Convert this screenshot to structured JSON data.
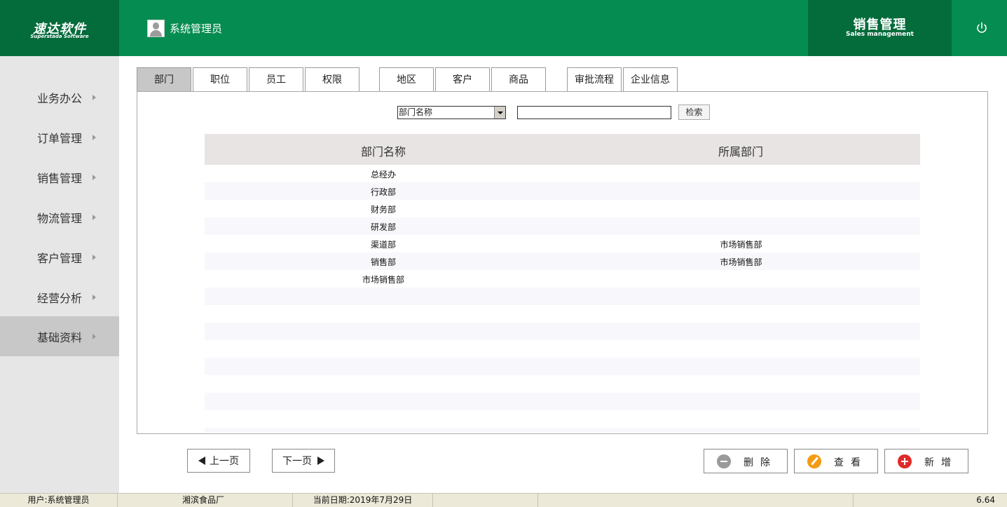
{
  "header": {
    "logo_cn": "速达软件",
    "logo_en": "Superstada Software",
    "user_name": "系统管理员",
    "module_cn": "销售管理",
    "module_en": "Sales management"
  },
  "sidebar": {
    "items": [
      {
        "label": "业务办公"
      },
      {
        "label": "订单管理"
      },
      {
        "label": "销售管理"
      },
      {
        "label": "物流管理"
      },
      {
        "label": "客户管理"
      },
      {
        "label": "经营分析"
      },
      {
        "label": "基础资料",
        "active": true
      }
    ]
  },
  "tabs": [
    {
      "label": "部门",
      "active": true
    },
    {
      "label": "职位"
    },
    {
      "label": "员工"
    },
    {
      "label": "权限"
    },
    {
      "label": "地区"
    },
    {
      "label": "客户"
    },
    {
      "label": "商品"
    },
    {
      "label": "审批流程"
    },
    {
      "label": "企业信息"
    }
  ],
  "search": {
    "field_selected": "部门名称",
    "query": "",
    "button_label": "检索"
  },
  "table": {
    "columns": [
      "部门名称",
      "所属部门"
    ],
    "rows": [
      [
        "总经办",
        ""
      ],
      [
        "行政部",
        ""
      ],
      [
        "财务部",
        ""
      ],
      [
        "研发部",
        ""
      ],
      [
        "渠道部",
        "市场销售部"
      ],
      [
        "销售部",
        "市场销售部"
      ],
      [
        "市场销售部",
        ""
      ]
    ]
  },
  "pager": {
    "prev_label": "上一页",
    "next_label": "下一页"
  },
  "actions": {
    "delete_label": "删除",
    "view_label": "查看",
    "add_label": "新增"
  },
  "statusbar": {
    "user": "用户:系统管理员",
    "company": "湘滨食品厂",
    "date": "当前日期:2019年7月29日",
    "version": "6.64"
  },
  "colors": {
    "header_green": "#058c50",
    "dark_green": "#046b3b"
  }
}
